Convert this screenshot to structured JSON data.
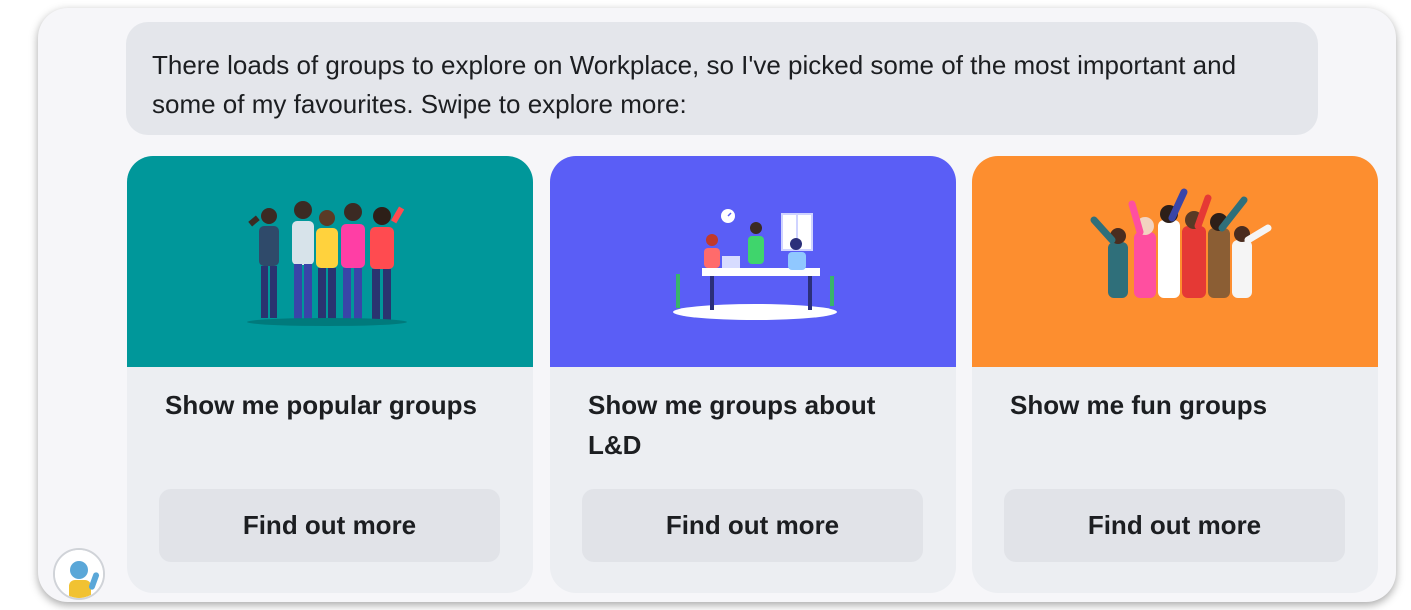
{
  "message": {
    "text": "There loads of groups to explore on Workplace, so I've picked some of the most important and some of my favourites. Swipe to explore more:"
  },
  "cards": [
    {
      "title": "Show me popular groups",
      "button_label": "Find out more",
      "color": "#00979a",
      "icon": "group-of-people-illustration"
    },
    {
      "title": "Show me groups about L&D",
      "button_label": "Find out more",
      "color": "#5a5ef6",
      "icon": "team-meeting-illustration"
    },
    {
      "title": "Show me fun groups",
      "button_label": "Find out more",
      "color": "#fd8e2f",
      "icon": "cheering-crowd-illustration"
    }
  ],
  "avatar": {
    "icon": "bot-avatar-icon"
  }
}
